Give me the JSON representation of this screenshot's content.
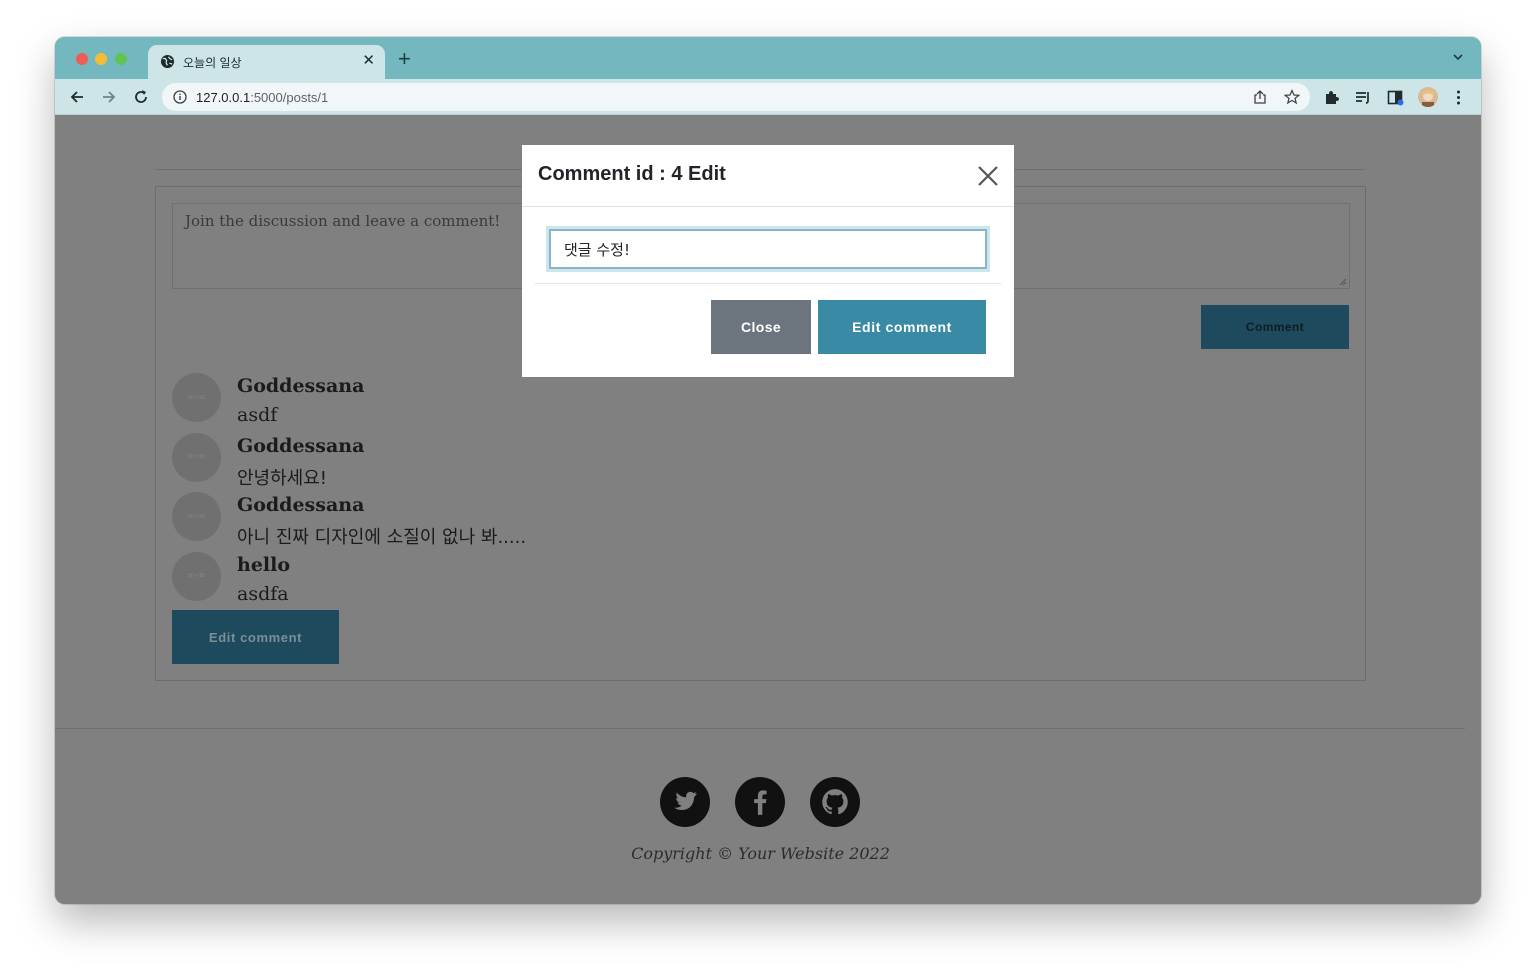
{
  "browser": {
    "tab_title": "오늘의 일상",
    "url_host": "127.0.0.1",
    "url_path": ":5000/posts/1"
  },
  "comment_form": {
    "placeholder": "Join the discussion and leave a comment!",
    "submit_label": "Comment"
  },
  "comments": [
    {
      "author": "Goddessana",
      "text": "asdf",
      "avatar_text": "50 × 50"
    },
    {
      "author": "Goddessana",
      "text": "안녕하세요!",
      "avatar_text": "50 × 50"
    },
    {
      "author": "Goddessana",
      "text": "아니 진짜 디자인에 소질이 없나 봐.....",
      "avatar_text": "50 × 50"
    },
    {
      "author": "hello",
      "text": "asdfa",
      "avatar_text": "50 × 50"
    }
  ],
  "edit_button_label": "Edit comment",
  "footer": {
    "social": [
      "twitter-icon",
      "facebook-icon",
      "github-icon"
    ],
    "copyright": "Copyright © Your Website 2022"
  },
  "modal": {
    "title": "Comment id : 4 Edit",
    "input_value": "댓글 수정!",
    "close_label": "Close",
    "submit_label": "Edit comment"
  },
  "colors": {
    "tab_strip": "#74b8bf",
    "overlay": "#808080",
    "primary": "#3a8aa5",
    "secondary": "#6c757d"
  }
}
